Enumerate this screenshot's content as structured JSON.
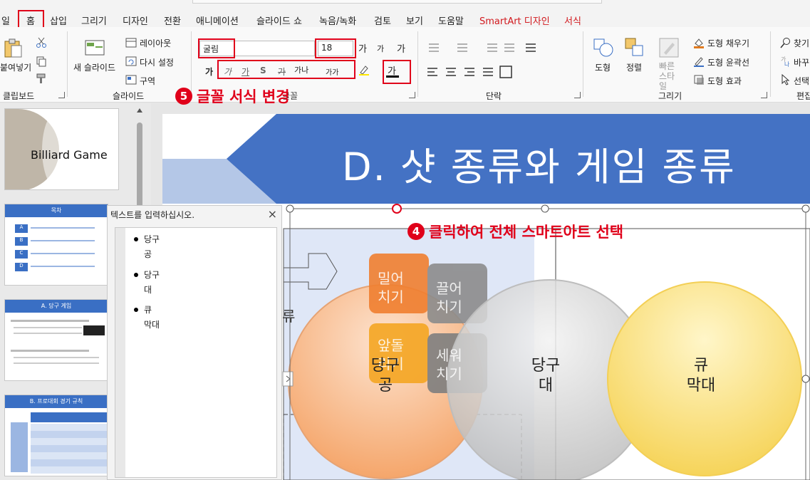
{
  "menu": {
    "tabs": [
      "일",
      "홈",
      "삽입",
      "그리기",
      "디자인",
      "전환",
      "애니메이션",
      "슬라이드 쇼",
      "녹음/녹화",
      "검토",
      "보기",
      "도움말",
      "SmartArt 디자인",
      "서식"
    ]
  },
  "ribbon": {
    "clipboard": {
      "paste_label": "붙여넣기",
      "group_label": "클립보드"
    },
    "slides": {
      "new_slide_label": "새 슬라이드",
      "layout_label": "레이아웃",
      "reset_label": "다시 설정",
      "section_label": "구역",
      "group_label": "슬라이드"
    },
    "font": {
      "font_name": "굴림",
      "font_size": "18",
      "grow_label": "가",
      "shrink_label": "가",
      "clear_label": "가",
      "bold_label": "가",
      "italic_label": "가",
      "underline_label": "가",
      "shadow_label": "S",
      "strike_label": "가",
      "spacing_label": "가나",
      "case_label": "가가",
      "color_label": "가",
      "group_label": "글꼴"
    },
    "paragraph": {
      "group_label": "단락"
    },
    "drawing": {
      "shape_label": "도형",
      "arrange_label": "정렬",
      "quick_style_label": "빠른 스타일",
      "fill_label": "도형 채우기",
      "outline_label": "도형 윤곽선",
      "effect_label": "도형 효과",
      "group_label": "그리기"
    },
    "editing": {
      "find_label": "찾기",
      "replace_label": "바꾸",
      "select_label": "선택",
      "group_label": "편집"
    }
  },
  "callouts": {
    "step5": {
      "number": "5",
      "text": "글꼴 서식 변경"
    },
    "step4": {
      "number": "4",
      "text": "클릭하여 전체 스마트아트 선택"
    }
  },
  "thumbnails": [
    {
      "title": "Billiard Game"
    },
    {
      "title": "목차",
      "rows": [
        "A",
        "B",
        "C",
        "D"
      ]
    },
    {
      "title": "A. 당구 게임"
    },
    {
      "title": "B. 프로대회 경기 규칙"
    }
  ],
  "slide": {
    "title": "D. 샷 종류와 게임 종류",
    "cube_labels": [
      "밀어\n치기",
      "끌어\n치기",
      "앞돌\n리기",
      "세워\n치기"
    ],
    "partial_label": "류",
    "circles": [
      {
        "label": "당구\n공"
      },
      {
        "label": "당구\n대"
      },
      {
        "label": "큐\n막대"
      }
    ]
  },
  "text_pane": {
    "title": "텍스트를 입력하십시오.",
    "items": [
      {
        "line1": "당구",
        "line2": "공"
      },
      {
        "line1": "당구",
        "line2": "대"
      },
      {
        "line1": "큐",
        "line2": "막대"
      }
    ]
  },
  "colors": {
    "accent_red": "#e0001a",
    "slide_blue": "#4472c4",
    "smartart_tab": "#d2191e"
  }
}
